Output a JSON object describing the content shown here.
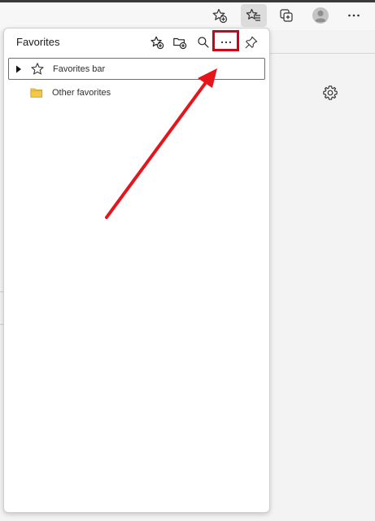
{
  "panel": {
    "title": "Favorites",
    "header_icons": [
      "add-favorite-icon",
      "add-folder-icon",
      "search-icon",
      "more-options-icon",
      "pin-icon"
    ]
  },
  "favorites": [
    {
      "label": "Favorites bar",
      "icon": "star-icon",
      "expandable": true,
      "selected": true
    },
    {
      "label": "Other favorites",
      "icon": "folder-icon",
      "expandable": false,
      "selected": false
    }
  ],
  "toolbar_icons": [
    "add-favorite-icon",
    "favorites-icon",
    "collections-icon",
    "profile-avatar",
    "settings-more-icon"
  ],
  "colors": {
    "highlight": "#d0021b",
    "arrow": "#e8141c",
    "folder": "#f2c94c"
  }
}
